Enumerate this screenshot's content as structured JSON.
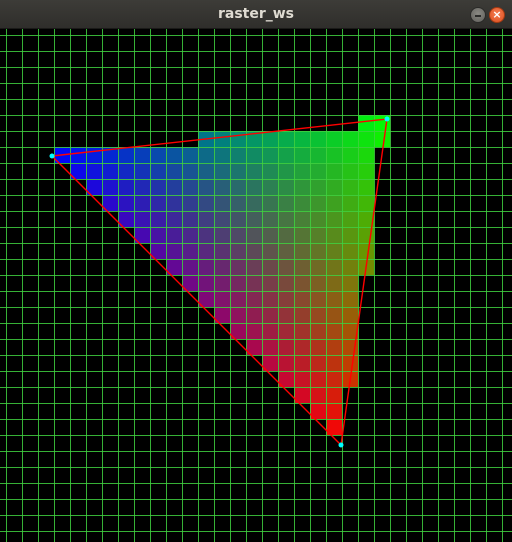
{
  "window": {
    "title": "raster_ws"
  },
  "titlebar_buttons": {
    "minimize_icon": "minimize-icon",
    "close_icon": "close-icon",
    "close_glyph": "×"
  },
  "colors": {
    "background": "#000000",
    "grid": "#40d040",
    "edge": "#ff0000",
    "vertex": "#00ffff",
    "vertex_a": "#0000ff",
    "vertex_b": "#00ff00",
    "vertex_c": "#ff0000"
  }
}
